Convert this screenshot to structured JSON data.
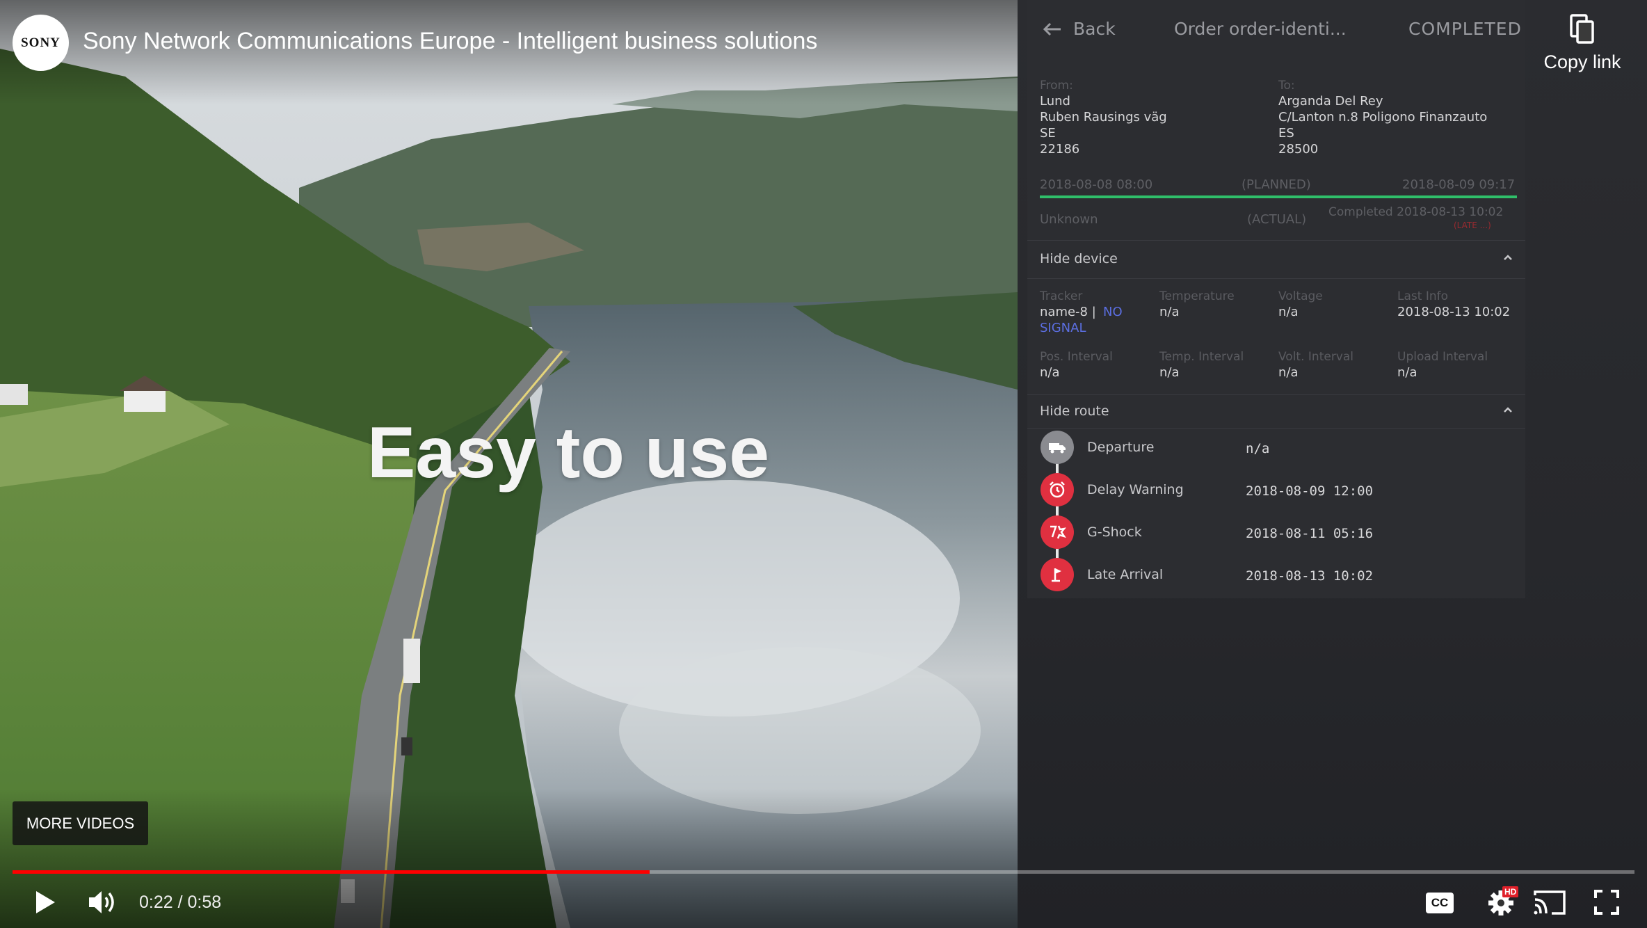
{
  "video": {
    "channel_logo_text": "SONY",
    "title": "Sony Network Communications Europe - Intelligent business solutions",
    "overlay_caption": "Easy to use",
    "copy_link_label": "Copy link",
    "more_videos_label": "MORE VIDEOS",
    "time_current": "0:22",
    "time_separator": "/",
    "time_total": "0:58",
    "progress_fraction": 0.393,
    "hd_badge": "HD",
    "cc_label": "CC"
  },
  "order": {
    "back_label": "Back",
    "title": "Order order-identi...",
    "status": "COMPLETED",
    "from_label": "From:",
    "from_lines": [
      "Lund",
      "Ruben Rausings väg",
      "SE",
      "22186"
    ],
    "to_label": "To:",
    "to_lines": [
      "Arganda Del Rey",
      "C/Lanton n.8 Poligono Finanzauto",
      "ES",
      "28500"
    ],
    "planned_start": "2018-08-08 08:00",
    "planned_label": "(PLANNED)",
    "planned_end": "2018-08-09 09:17",
    "actual_start": "Unknown",
    "actual_label": "(ACTUAL)",
    "actual_end": "Completed 2018-08-13 10:02",
    "actual_delay": "(LATE ...)",
    "device_section": "Hide device",
    "device": {
      "tracker_label": "Tracker",
      "tracker_value": "name-8 |",
      "tracker_signal_1": "NO",
      "tracker_signal_2": "SIGNAL",
      "temperature_label": "Temperature",
      "temperature_value": "n/a",
      "voltage_label": "Voltage",
      "voltage_value": "n/a",
      "last_info_label": "Last Info",
      "last_info_value": "2018-08-13 10:02",
      "pos_interval_label": "Pos. Interval",
      "pos_interval_value": "n/a",
      "temp_interval_label": "Temp. Interval",
      "temp_interval_value": "n/a",
      "volt_interval_label": "Volt. Interval",
      "volt_interval_value": "n/a",
      "upload_interval_label": "Upload Interval",
      "upload_interval_value": "n/a"
    },
    "route_section": "Hide route",
    "route": [
      {
        "event": "Departure",
        "time": "n/a"
      },
      {
        "event": "Delay Warning",
        "time": "2018-08-09 12:00"
      },
      {
        "event": "G-Shock",
        "time": "2018-08-11 05:16"
      },
      {
        "event": "Late Arrival",
        "time": "2018-08-13 10:02"
      }
    ]
  },
  "colors": {
    "progress": "#ff0000",
    "route_alert": "#e03040",
    "route_neutral": "#8a8b90",
    "signal_link": "#5b6ee0",
    "planned_bar": "#2fbf6a"
  }
}
